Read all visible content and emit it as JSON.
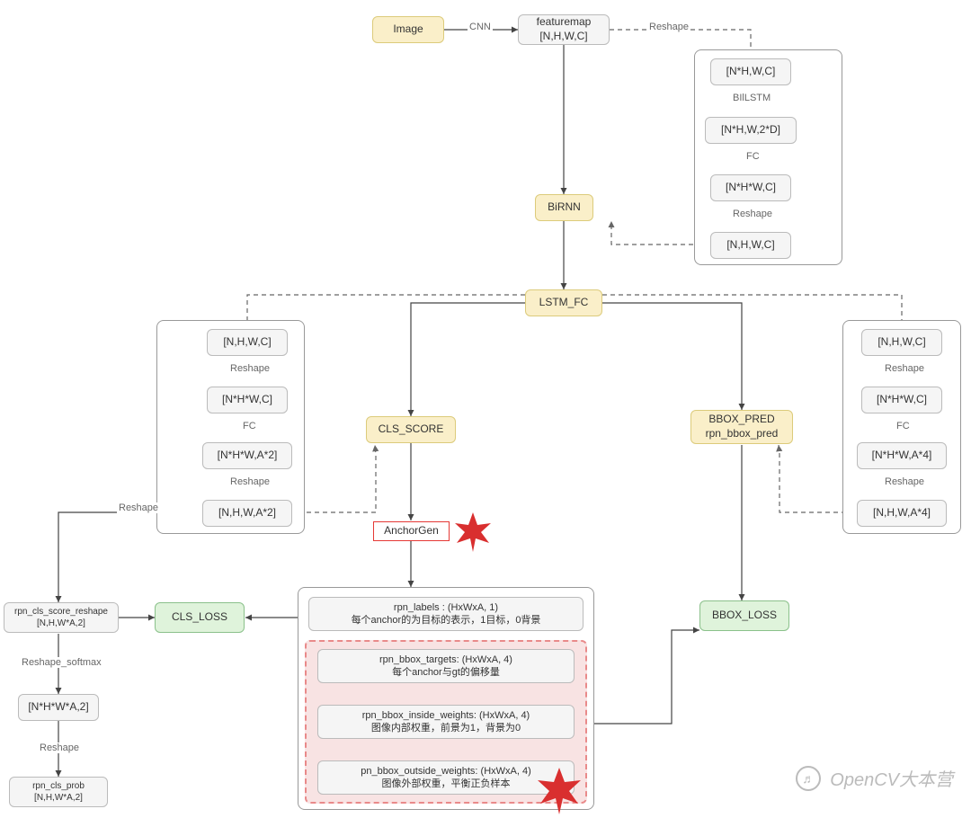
{
  "nodes": {
    "image": "Image",
    "featuremap": "featuremap\n[N,H,W,C]",
    "birnn": "BiRNN",
    "lstm_fc": "LSTM_FC",
    "cls_score": "CLS_SCORE",
    "bbox_pred": "BBOX_PRED\nrpn_bbox_pred",
    "anchorgen": "AnchorGen",
    "cls_loss": "CLS_LOSS",
    "bbox_loss": "BBOX_LOSS",
    "rpn_cls_score_reshape": "rpn_cls_score_reshape\n[N,H,W*A,2]",
    "nhwa2b": "[N*H*W*A,2]",
    "rpn_cls_prob": "rpn_cls_prob\n[N,H,W*A,2]",
    "g_top_1": "[N*H,W,C]",
    "g_top_2": "[N*H,W,2*D]",
    "g_top_3": "[N*H*W,C]",
    "g_top_4": "[N,H,W,C]",
    "g_left_1": "[N,H,W,C]",
    "g_left_2": "[N*H*W,C]",
    "g_left_3": "[N*H*W,A*2]",
    "g_left_4": "[N,H,W,A*2]",
    "g_right_1": "[N,H,W,C]",
    "g_right_2": "[N*H*W,C]",
    "g_right_3": "[N*H*W,A*4]",
    "g_right_4": "[N,H,W,A*4]",
    "rpn_labels": "rpn_labels : (HxWxA, 1)\n每个anchor的为目标的表示，1目标，0背景",
    "rpn_bbox_targets": "rpn_bbox_targets: (HxWxA, 4)\n每个anchor与gt的偏移量",
    "rpn_bbox_inside": "rpn_bbox_inside_weights: (HxWxA, 4)\n图像内部权重，前景为1，背景为0",
    "rpn_bbox_outside": "pn_bbox_outside_weights: (HxWxA, 4)\n图像外部权重，平衡正负样本"
  },
  "labels": {
    "cnn": "CNN",
    "reshape": "Reshape",
    "bilstm": "BIlLSTM",
    "fc": "FC",
    "reshape_softmax": "Reshape_softmax"
  },
  "watermark": "OpenCV大本营",
  "watermark_icon": "♬"
}
